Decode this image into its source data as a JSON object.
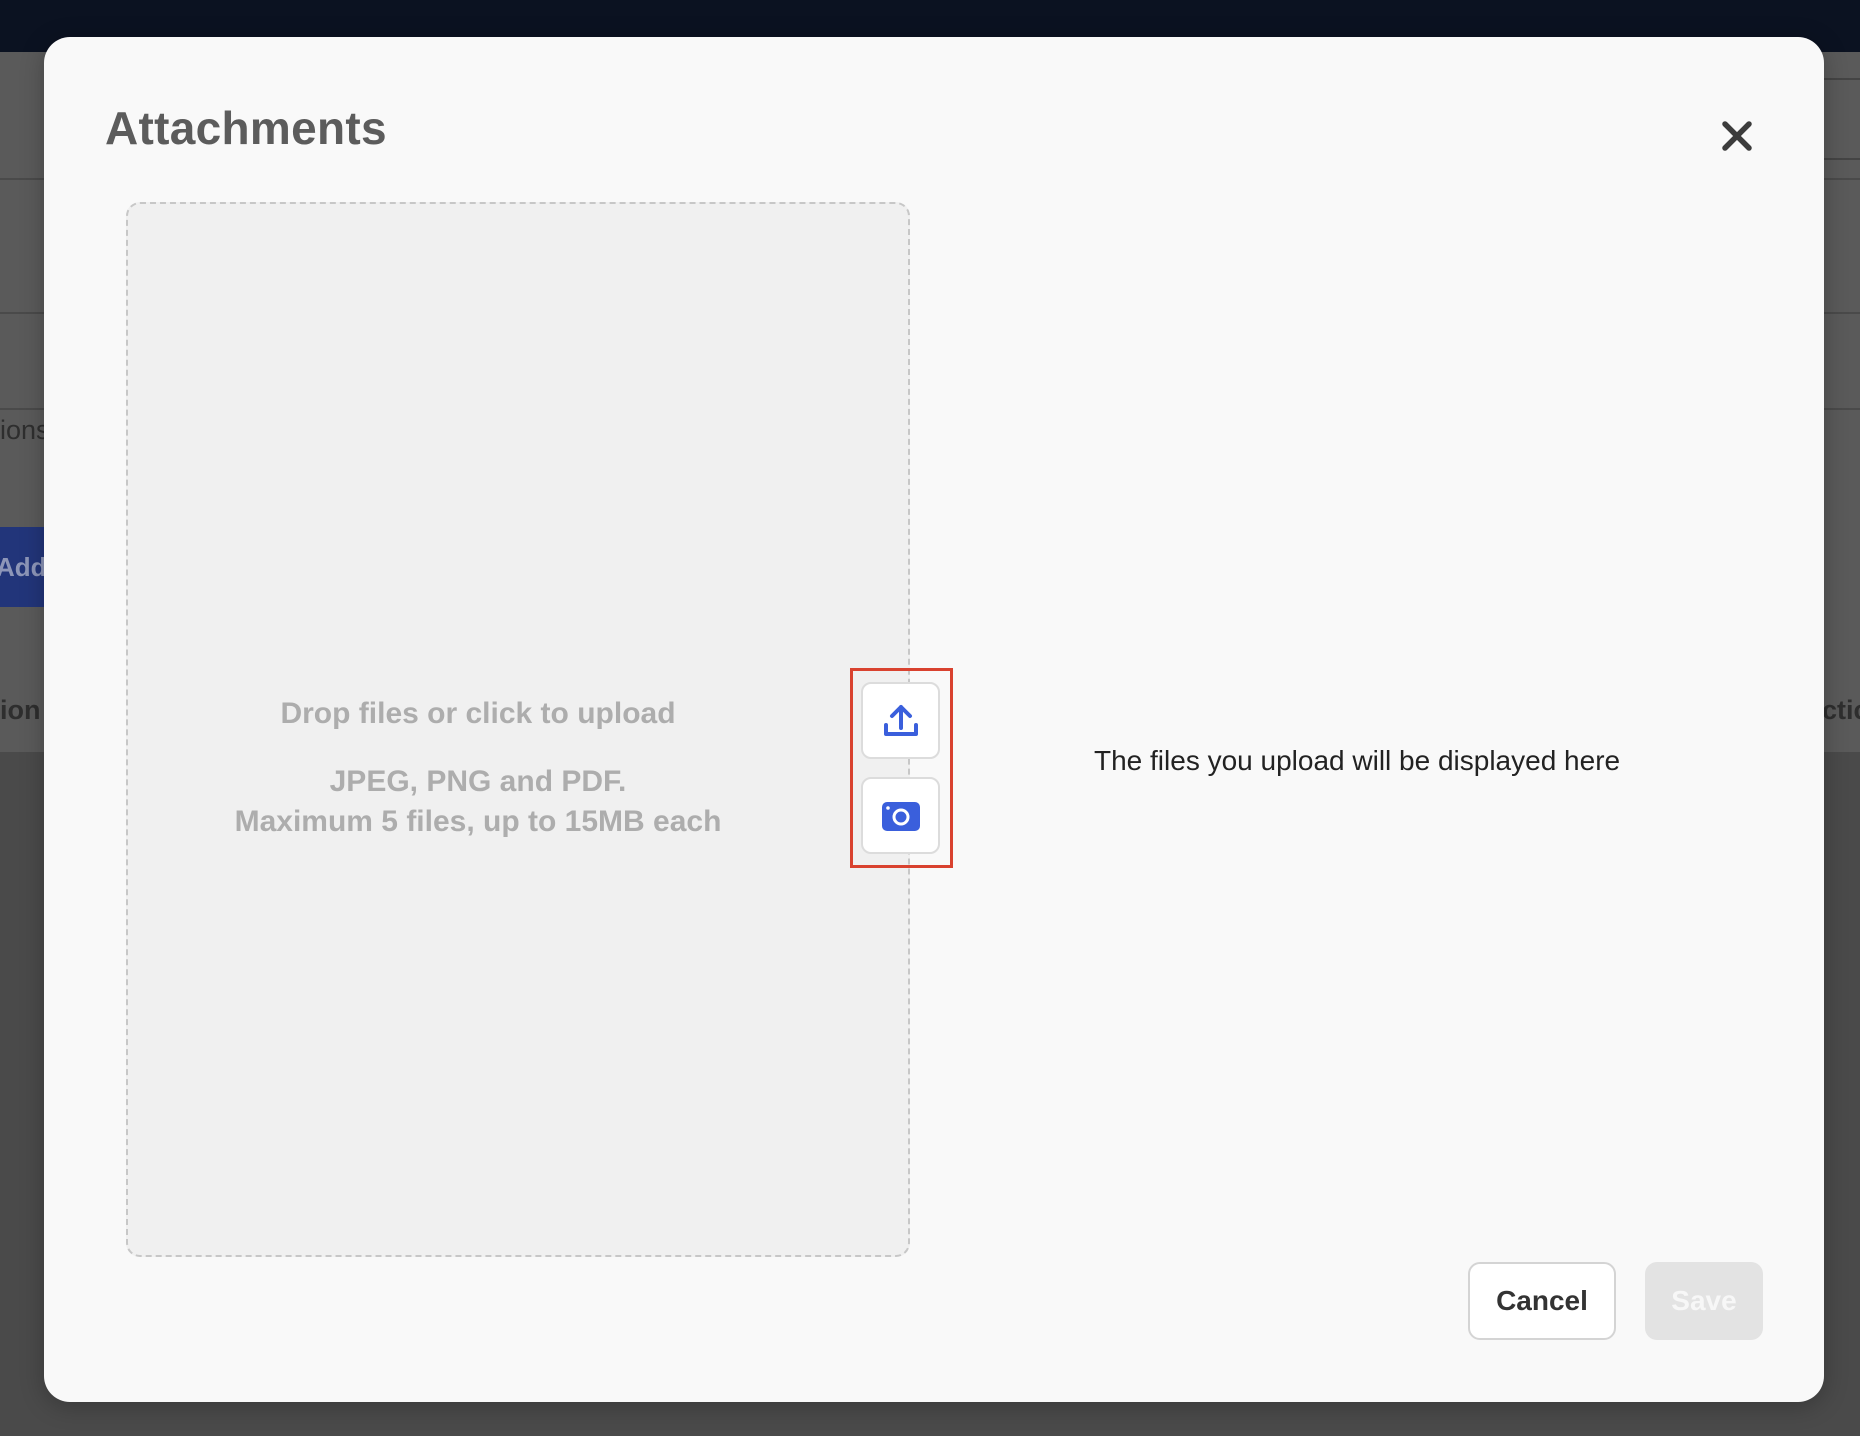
{
  "background": {
    "partial_labels": [
      "ions",
      "Add",
      "ion /",
      "ctic"
    ]
  },
  "modal": {
    "title": "Attachments",
    "close_icon": "close-icon",
    "dropzone": {
      "title": "Drop files or click to upload",
      "formats": "JPEG, PNG and PDF.",
      "limits": "Maximum 5 files, up to 15MB each",
      "upload_icon": "upload-icon",
      "camera_icon": "camera-icon"
    },
    "empty_hint": "The files you upload will be displayed here",
    "cancel_label": "Cancel",
    "save_label": "Save"
  },
  "colors": {
    "accent": "#3a5fdc",
    "highlight": "#d9422f",
    "topbar": "#0b1221"
  }
}
